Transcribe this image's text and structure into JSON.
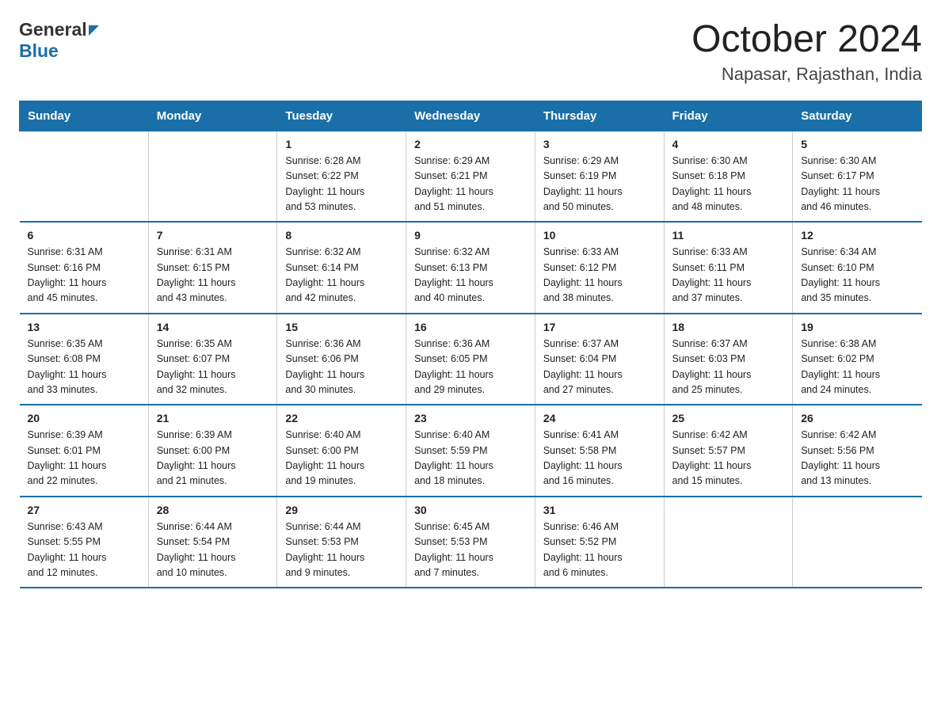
{
  "header": {
    "title": "October 2024",
    "subtitle": "Napasar, Rajasthan, India",
    "logo_general": "General",
    "logo_blue": "Blue"
  },
  "days_of_week": [
    "Sunday",
    "Monday",
    "Tuesday",
    "Wednesday",
    "Thursday",
    "Friday",
    "Saturday"
  ],
  "weeks": [
    [
      {
        "day": "",
        "info": ""
      },
      {
        "day": "",
        "info": ""
      },
      {
        "day": "1",
        "info": "Sunrise: 6:28 AM\nSunset: 6:22 PM\nDaylight: 11 hours\nand 53 minutes."
      },
      {
        "day": "2",
        "info": "Sunrise: 6:29 AM\nSunset: 6:21 PM\nDaylight: 11 hours\nand 51 minutes."
      },
      {
        "day": "3",
        "info": "Sunrise: 6:29 AM\nSunset: 6:19 PM\nDaylight: 11 hours\nand 50 minutes."
      },
      {
        "day": "4",
        "info": "Sunrise: 6:30 AM\nSunset: 6:18 PM\nDaylight: 11 hours\nand 48 minutes."
      },
      {
        "day": "5",
        "info": "Sunrise: 6:30 AM\nSunset: 6:17 PM\nDaylight: 11 hours\nand 46 minutes."
      }
    ],
    [
      {
        "day": "6",
        "info": "Sunrise: 6:31 AM\nSunset: 6:16 PM\nDaylight: 11 hours\nand 45 minutes."
      },
      {
        "day": "7",
        "info": "Sunrise: 6:31 AM\nSunset: 6:15 PM\nDaylight: 11 hours\nand 43 minutes."
      },
      {
        "day": "8",
        "info": "Sunrise: 6:32 AM\nSunset: 6:14 PM\nDaylight: 11 hours\nand 42 minutes."
      },
      {
        "day": "9",
        "info": "Sunrise: 6:32 AM\nSunset: 6:13 PM\nDaylight: 11 hours\nand 40 minutes."
      },
      {
        "day": "10",
        "info": "Sunrise: 6:33 AM\nSunset: 6:12 PM\nDaylight: 11 hours\nand 38 minutes."
      },
      {
        "day": "11",
        "info": "Sunrise: 6:33 AM\nSunset: 6:11 PM\nDaylight: 11 hours\nand 37 minutes."
      },
      {
        "day": "12",
        "info": "Sunrise: 6:34 AM\nSunset: 6:10 PM\nDaylight: 11 hours\nand 35 minutes."
      }
    ],
    [
      {
        "day": "13",
        "info": "Sunrise: 6:35 AM\nSunset: 6:08 PM\nDaylight: 11 hours\nand 33 minutes."
      },
      {
        "day": "14",
        "info": "Sunrise: 6:35 AM\nSunset: 6:07 PM\nDaylight: 11 hours\nand 32 minutes."
      },
      {
        "day": "15",
        "info": "Sunrise: 6:36 AM\nSunset: 6:06 PM\nDaylight: 11 hours\nand 30 minutes."
      },
      {
        "day": "16",
        "info": "Sunrise: 6:36 AM\nSunset: 6:05 PM\nDaylight: 11 hours\nand 29 minutes."
      },
      {
        "day": "17",
        "info": "Sunrise: 6:37 AM\nSunset: 6:04 PM\nDaylight: 11 hours\nand 27 minutes."
      },
      {
        "day": "18",
        "info": "Sunrise: 6:37 AM\nSunset: 6:03 PM\nDaylight: 11 hours\nand 25 minutes."
      },
      {
        "day": "19",
        "info": "Sunrise: 6:38 AM\nSunset: 6:02 PM\nDaylight: 11 hours\nand 24 minutes."
      }
    ],
    [
      {
        "day": "20",
        "info": "Sunrise: 6:39 AM\nSunset: 6:01 PM\nDaylight: 11 hours\nand 22 minutes."
      },
      {
        "day": "21",
        "info": "Sunrise: 6:39 AM\nSunset: 6:00 PM\nDaylight: 11 hours\nand 21 minutes."
      },
      {
        "day": "22",
        "info": "Sunrise: 6:40 AM\nSunset: 6:00 PM\nDaylight: 11 hours\nand 19 minutes."
      },
      {
        "day": "23",
        "info": "Sunrise: 6:40 AM\nSunset: 5:59 PM\nDaylight: 11 hours\nand 18 minutes."
      },
      {
        "day": "24",
        "info": "Sunrise: 6:41 AM\nSunset: 5:58 PM\nDaylight: 11 hours\nand 16 minutes."
      },
      {
        "day": "25",
        "info": "Sunrise: 6:42 AM\nSunset: 5:57 PM\nDaylight: 11 hours\nand 15 minutes."
      },
      {
        "day": "26",
        "info": "Sunrise: 6:42 AM\nSunset: 5:56 PM\nDaylight: 11 hours\nand 13 minutes."
      }
    ],
    [
      {
        "day": "27",
        "info": "Sunrise: 6:43 AM\nSunset: 5:55 PM\nDaylight: 11 hours\nand 12 minutes."
      },
      {
        "day": "28",
        "info": "Sunrise: 6:44 AM\nSunset: 5:54 PM\nDaylight: 11 hours\nand 10 minutes."
      },
      {
        "day": "29",
        "info": "Sunrise: 6:44 AM\nSunset: 5:53 PM\nDaylight: 11 hours\nand 9 minutes."
      },
      {
        "day": "30",
        "info": "Sunrise: 6:45 AM\nSunset: 5:53 PM\nDaylight: 11 hours\nand 7 minutes."
      },
      {
        "day": "31",
        "info": "Sunrise: 6:46 AM\nSunset: 5:52 PM\nDaylight: 11 hours\nand 6 minutes."
      },
      {
        "day": "",
        "info": ""
      },
      {
        "day": "",
        "info": ""
      }
    ]
  ]
}
